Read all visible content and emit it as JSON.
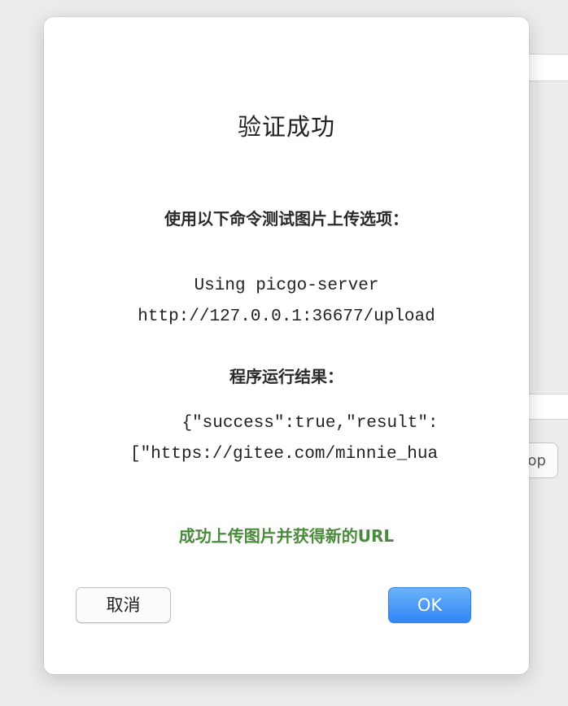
{
  "dialog": {
    "title": "验证成功",
    "instruction": "使用以下命令测试图片上传选项：",
    "command_line1": "Using picgo-server",
    "command_line2": "http://127.0.0.1:36677/upload",
    "result_label": "程序运行结果：",
    "result_line1": "{\"success\":true,\"result\":",
    "result_line2": "[\"https://gitee.com/minnie_hua",
    "success_message": "成功上传图片并获得新的URL",
    "cancel_label": "取消",
    "ok_label": "OK"
  },
  "background": {
    "button_fragment": "op"
  },
  "colors": {
    "success_text": "#4a8a3c",
    "ok_button": "#3b8ef6"
  }
}
